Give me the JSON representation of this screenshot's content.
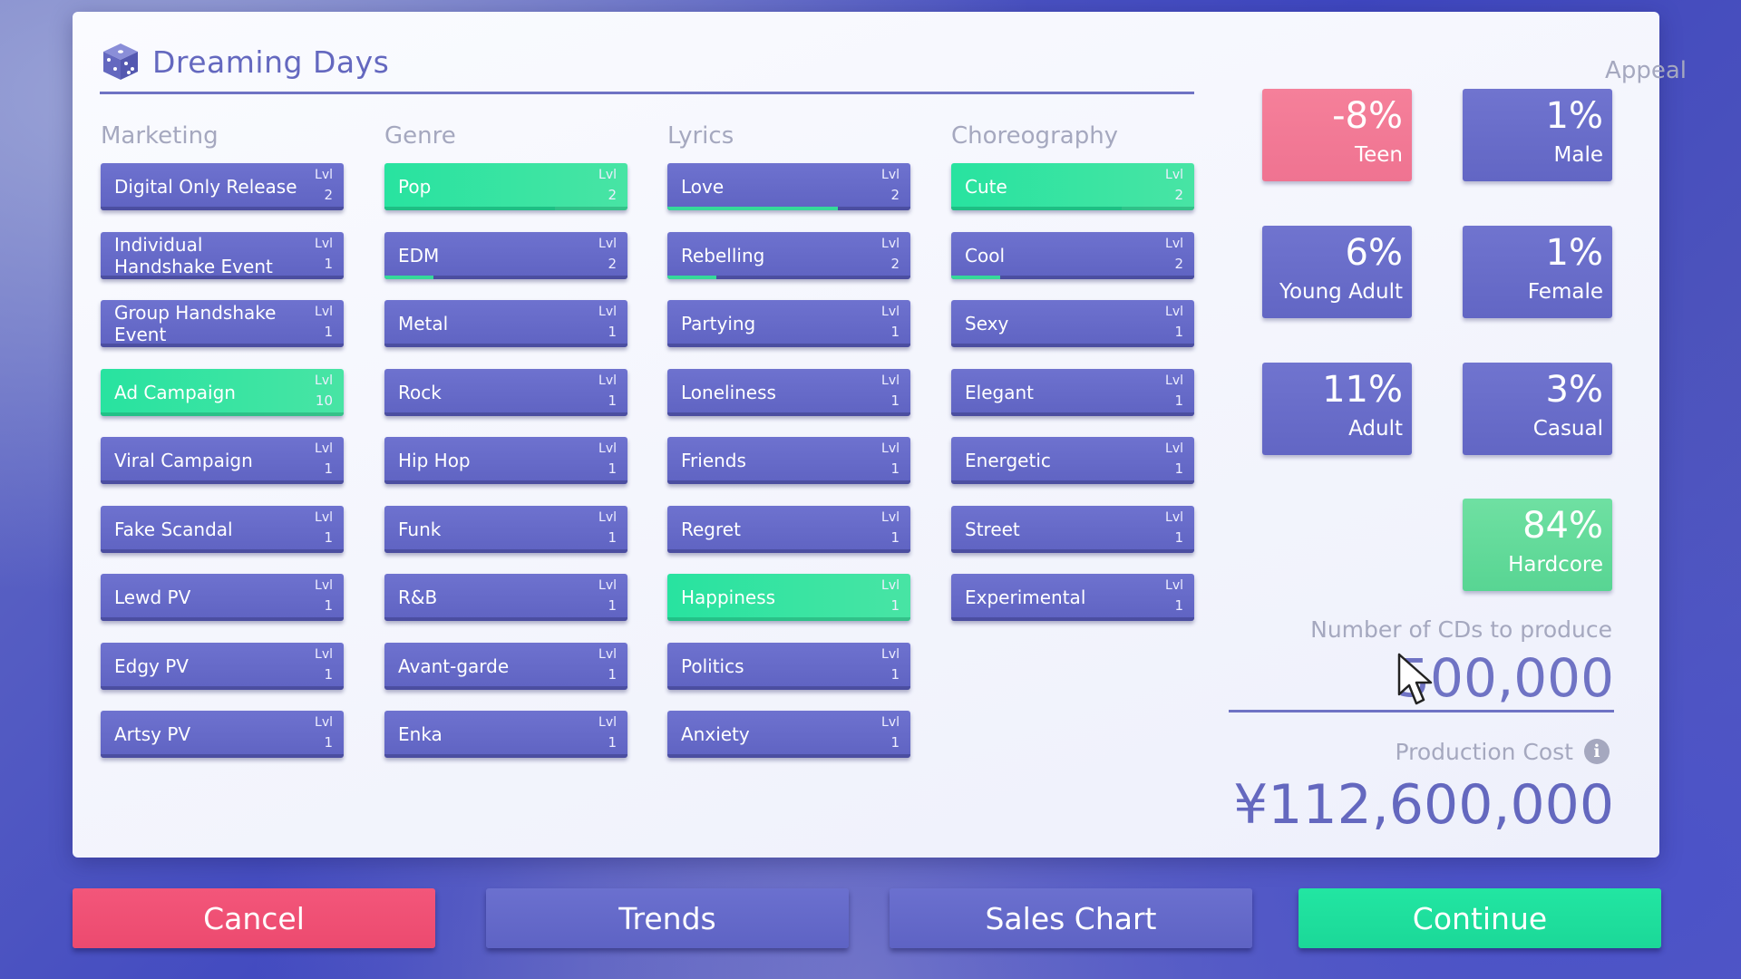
{
  "song": {
    "title": "Dreaming Days",
    "icon": "dice-icon"
  },
  "lvl_tag": "Lvl",
  "categories": [
    {
      "title": "Marketing",
      "options": [
        {
          "label": "Digital Only Release",
          "level": "2",
          "active": false,
          "progress": 0
        },
        {
          "label": "Individual Handshake Event",
          "level": "1",
          "active": false,
          "progress": 0
        },
        {
          "label": "Group Handshake Event",
          "level": "1",
          "active": false,
          "progress": 0
        },
        {
          "label": "Ad Campaign",
          "level": "10",
          "active": true,
          "progress": 0
        },
        {
          "label": "Viral Campaign",
          "level": "1",
          "active": false,
          "progress": 0
        },
        {
          "label": "Fake Scandal",
          "level": "1",
          "active": false,
          "progress": 0
        },
        {
          "label": "Lewd PV",
          "level": "1",
          "active": false,
          "progress": 0
        },
        {
          "label": "Edgy PV",
          "level": "1",
          "active": false,
          "progress": 0
        },
        {
          "label": "Artsy PV",
          "level": "1",
          "active": false,
          "progress": 0
        }
      ]
    },
    {
      "title": "Genre",
      "options": [
        {
          "label": "Pop",
          "level": "2",
          "active": true,
          "progress": 0.7
        },
        {
          "label": "EDM",
          "level": "2",
          "active": false,
          "progress": 0.2
        },
        {
          "label": "Metal",
          "level": "1",
          "active": false,
          "progress": 0
        },
        {
          "label": "Rock",
          "level": "1",
          "active": false,
          "progress": 0
        },
        {
          "label": "Hip Hop",
          "level": "1",
          "active": false,
          "progress": 0
        },
        {
          "label": "Funk",
          "level": "1",
          "active": false,
          "progress": 0
        },
        {
          "label": "R&B",
          "level": "1",
          "active": false,
          "progress": 0
        },
        {
          "label": "Avant-garde",
          "level": "1",
          "active": false,
          "progress": 0
        },
        {
          "label": "Enka",
          "level": "1",
          "active": false,
          "progress": 0
        }
      ]
    },
    {
      "title": "Lyrics",
      "options": [
        {
          "label": "Love",
          "level": "2",
          "active": false,
          "progress": 0.7
        },
        {
          "label": "Rebelling",
          "level": "2",
          "active": false,
          "progress": 0.2
        },
        {
          "label": "Partying",
          "level": "1",
          "active": false,
          "progress": 0
        },
        {
          "label": "Loneliness",
          "level": "1",
          "active": false,
          "progress": 0
        },
        {
          "label": "Friends",
          "level": "1",
          "active": false,
          "progress": 0
        },
        {
          "label": "Regret",
          "level": "1",
          "active": false,
          "progress": 0
        },
        {
          "label": "Happiness",
          "level": "1",
          "active": true,
          "progress": 0
        },
        {
          "label": "Politics",
          "level": "1",
          "active": false,
          "progress": 0
        },
        {
          "label": "Anxiety",
          "level": "1",
          "active": false,
          "progress": 0
        }
      ]
    },
    {
      "title": "Choreography",
      "options": [
        {
          "label": "Cute",
          "level": "2",
          "active": true,
          "progress": 0.7
        },
        {
          "label": "Cool",
          "level": "2",
          "active": false,
          "progress": 0.2
        },
        {
          "label": "Sexy",
          "level": "1",
          "active": false,
          "progress": 0
        },
        {
          "label": "Elegant",
          "level": "1",
          "active": false,
          "progress": 0
        },
        {
          "label": "Energetic",
          "level": "1",
          "active": false,
          "progress": 0
        },
        {
          "label": "Street",
          "level": "1",
          "active": false,
          "progress": 0
        },
        {
          "label": "Experimental",
          "level": "1",
          "active": false,
          "progress": 0
        }
      ]
    }
  ],
  "appeal": {
    "title": "Appeal",
    "tiles": [
      {
        "pct": "-8%",
        "label": "Teen",
        "tone": "neg"
      },
      {
        "pct": "1%",
        "label": "Male",
        "tone": "neutral"
      },
      {
        "pct": "6%",
        "label": "Young Adult",
        "tone": "neutral"
      },
      {
        "pct": "1%",
        "label": "Female",
        "tone": "neutral"
      },
      {
        "pct": "11%",
        "label": "Adult",
        "tone": "neutral"
      },
      {
        "pct": "3%",
        "label": "Casual",
        "tone": "neutral"
      },
      {
        "pct": "84%",
        "label": "Hardcore",
        "tone": "pos"
      }
    ]
  },
  "production": {
    "cd_label": "Number of CDs to produce",
    "cd_value": "500,000",
    "cost_label": "Production Cost",
    "info_icon": "i",
    "cost_value": "¥112,600,000"
  },
  "buttons": {
    "cancel": "Cancel",
    "trends": "Trends",
    "sales_chart": "Sales Chart",
    "continue": "Continue"
  },
  "colors": {
    "accent": "#6468bf",
    "active_green": "#2ee3a1",
    "negative_pink": "#f07593",
    "cancel_red": "#ef4f74"
  }
}
